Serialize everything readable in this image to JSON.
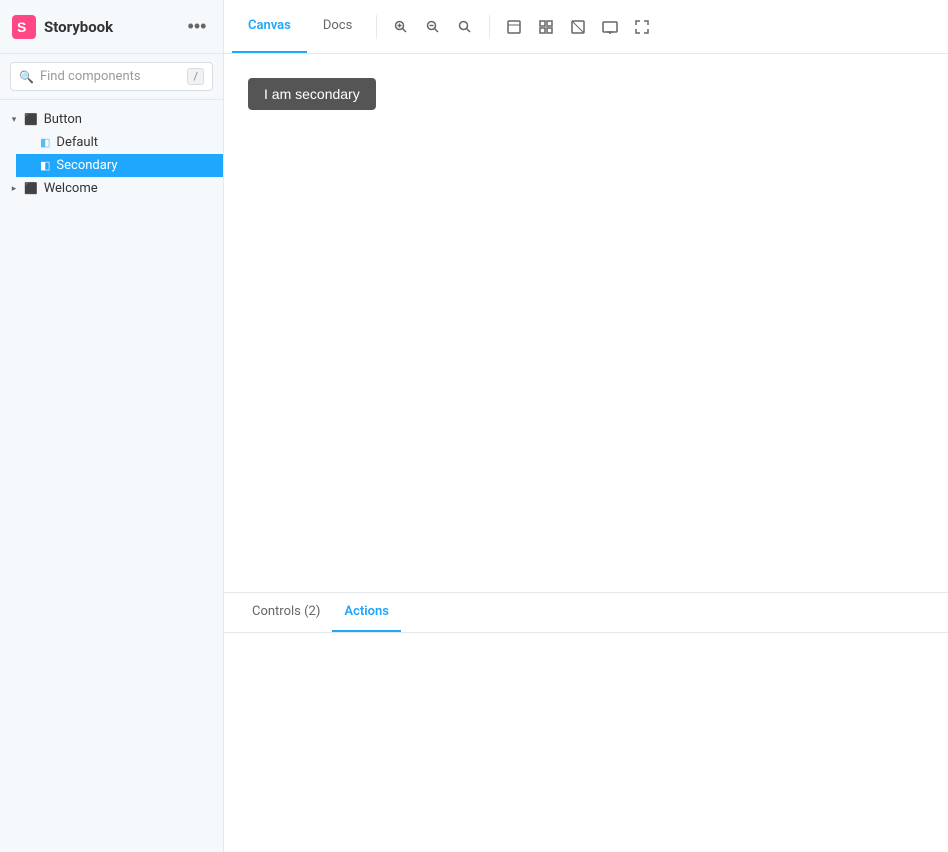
{
  "sidebar": {
    "logo_text": "Storybook",
    "search_placeholder": "Find components",
    "search_shortcut": "/",
    "tree": [
      {
        "id": "button",
        "label": "Button",
        "type": "component",
        "expanded": true,
        "children": [
          {
            "id": "default",
            "label": "Default",
            "type": "story",
            "selected": false
          },
          {
            "id": "secondary",
            "label": "Secondary",
            "type": "story",
            "selected": true
          }
        ]
      },
      {
        "id": "welcome",
        "label": "Welcome",
        "type": "component",
        "expanded": false,
        "children": []
      }
    ]
  },
  "main": {
    "tabs": [
      {
        "id": "canvas",
        "label": "Canvas",
        "active": true
      },
      {
        "id": "docs",
        "label": "Docs",
        "active": false
      }
    ],
    "toolbar_icons": [
      {
        "id": "zoom-in",
        "title": "Zoom in"
      },
      {
        "id": "zoom-out",
        "title": "Zoom out"
      },
      {
        "id": "zoom-reset",
        "title": "Reset zoom"
      },
      {
        "id": "view-component",
        "title": "View component"
      },
      {
        "id": "view-grid",
        "title": "View grid"
      },
      {
        "id": "background",
        "title": "Change background"
      },
      {
        "id": "viewport",
        "title": "Change viewport"
      },
      {
        "id": "fullscreen",
        "title": "Fullscreen"
      }
    ],
    "canvas": {
      "demo_button_label": "I am secondary"
    },
    "bottom_tabs": [
      {
        "id": "controls",
        "label": "Controls (2)",
        "active": false
      },
      {
        "id": "actions",
        "label": "Actions",
        "active": true
      }
    ]
  }
}
